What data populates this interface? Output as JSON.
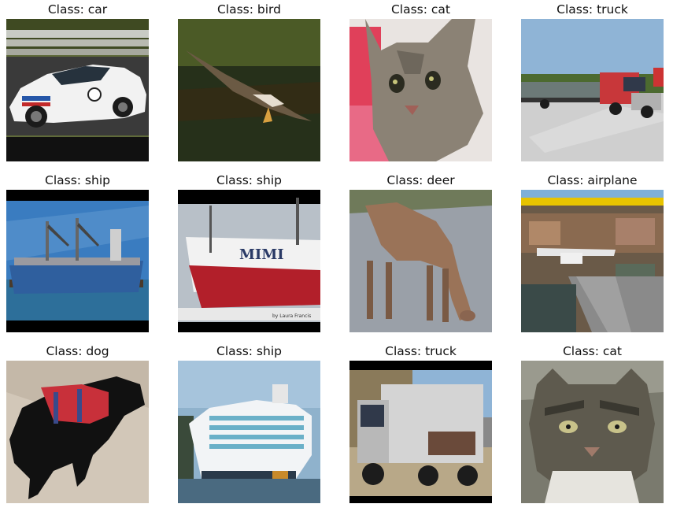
{
  "figure": {
    "panels": [
      {
        "title": "Class: car",
        "subject": "race-car"
      },
      {
        "title": "Class: bird",
        "subject": "bird"
      },
      {
        "title": "Class: cat",
        "subject": "cat-face"
      },
      {
        "title": "Class: truck",
        "subject": "semi-truck"
      },
      {
        "title": "Class: ship",
        "subject": "cargo-ship"
      },
      {
        "title": "Class: ship",
        "subject": "boat"
      },
      {
        "title": "Class: deer",
        "subject": "deer"
      },
      {
        "title": "Class: airplane",
        "subject": "seaplane-dock"
      },
      {
        "title": "Class: dog",
        "subject": "dog"
      },
      {
        "title": "Class: ship",
        "subject": "cruise-ship"
      },
      {
        "title": "Class: truck",
        "subject": "box-truck"
      },
      {
        "title": "Class: cat",
        "subject": "wild-cat"
      }
    ],
    "boat_text": "MIMI",
    "photo_credit": "by Laura Francis"
  }
}
